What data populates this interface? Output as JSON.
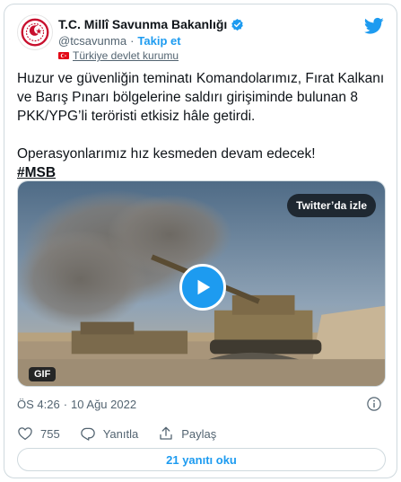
{
  "author": {
    "name": "T.C. Millî Savunma Bakanlığı",
    "handle": "@tcsavunma",
    "separator": "·",
    "follow_label": "Takip et",
    "label_text": "Türkiye devlet kurumu"
  },
  "tweet": {
    "paragraph1": "Huzur ve güvenliğin teminatı Komandolarımız, Fırat Kalkanı ve Barış Pınarı bölgelerine saldırı girişiminde bulunan 8 PKK/YPG’li teröristi etkisiz hâle getirdi.",
    "paragraph2": "Operasyonlarımız hız kesmeden devam edecek!",
    "hashtag": "#MSB"
  },
  "media": {
    "watch_label": "Twitter’da izle",
    "gif_label": "GIF"
  },
  "meta": {
    "time": "ÖS 4:26",
    "separator": "·",
    "date": "10 Ağu 2022"
  },
  "actions": {
    "like_count": "755",
    "reply_label": "Yanıtla",
    "share_label": "Paylaş"
  },
  "footer": {
    "read_replies_label": "21 yanıtı oku"
  },
  "colors": {
    "accent": "#1d9bf0",
    "text": "#0f1419",
    "muted": "#536471",
    "like_red": "#f91880"
  }
}
